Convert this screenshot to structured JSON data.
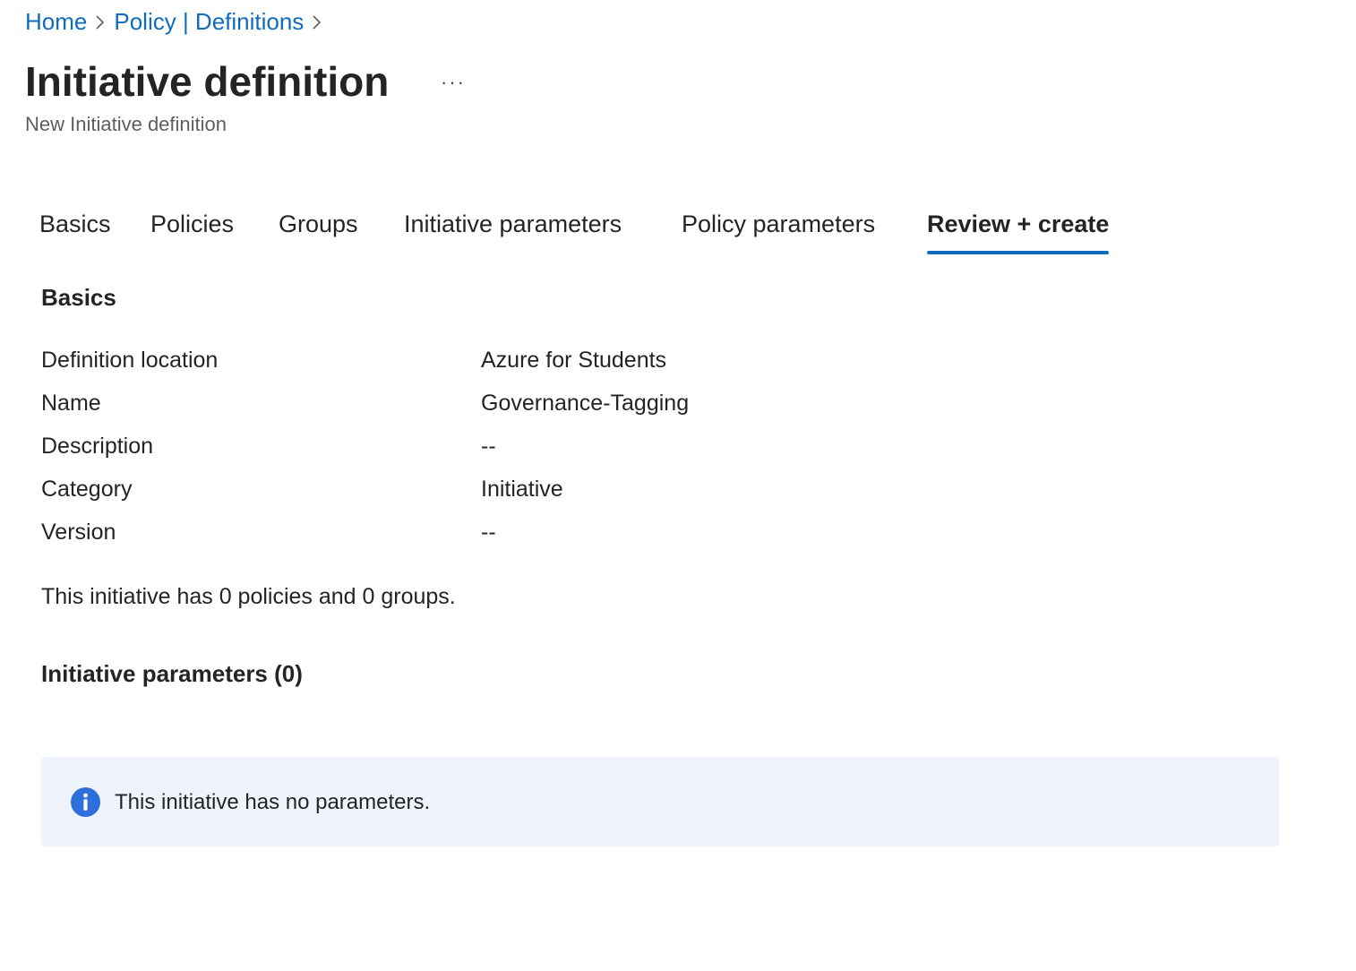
{
  "breadcrumb": {
    "items": [
      "Home",
      "Policy | Definitions"
    ]
  },
  "header": {
    "title": "Initiative definition",
    "more_label": "···",
    "subtitle": "New Initiative definition"
  },
  "tabs": [
    {
      "label": "Basics",
      "active": false
    },
    {
      "label": "Policies",
      "active": false
    },
    {
      "label": "Groups",
      "active": false
    },
    {
      "label": "Initiative parameters",
      "active": false
    },
    {
      "label": "Policy parameters",
      "active": false
    },
    {
      "label": "Review + create",
      "active": true
    }
  ],
  "basics": {
    "heading": "Basics",
    "rows": [
      {
        "label": "Definition location",
        "value": "Azure for Students"
      },
      {
        "label": "Name",
        "value": "Governance-Tagging"
      },
      {
        "label": "Description",
        "value": "--"
      },
      {
        "label": "Category",
        "value": "Initiative"
      },
      {
        "label": "Version",
        "value": "--"
      }
    ],
    "summary": "This initiative has 0 policies and 0 groups."
  },
  "initiative_parameters": {
    "heading": "Initiative parameters (0)",
    "info_message": "This initiative has no parameters."
  },
  "colors": {
    "link": "#0f6cbd",
    "accent": "#0f6cbd",
    "info_background": "#eff4fc",
    "info_icon": "#2f6fdc"
  }
}
